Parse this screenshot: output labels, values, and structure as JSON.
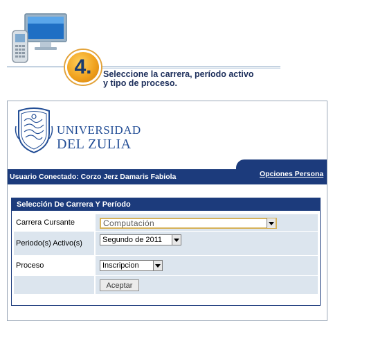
{
  "instruction": {
    "step_number": "4.",
    "text_line1": "Seleccione la carrera, período activo",
    "text_line2": "y tipo de proceso."
  },
  "university": {
    "line1": "UNIVERSIDAD",
    "line2": "DEL ZULIA"
  },
  "topbar": {
    "user_text": "Usuario Conectado: Corzo Jerz Damaris Fabiola",
    "options_link": "Opciones Persona"
  },
  "form": {
    "title": "Selección De Carrera Y Período",
    "career_label": "Carrera Cursante",
    "career_value": "Computación",
    "period_label": "Periodo(s) Activo(s)",
    "period_value": "Segundo de 2011",
    "process_label": "Proceso",
    "process_value": "Inscripcion",
    "submit_label": "Aceptar"
  },
  "colors": {
    "navy": "#1c3b7c",
    "row_shade": "#dce5ee",
    "badge_orange": "#f0a21f"
  }
}
